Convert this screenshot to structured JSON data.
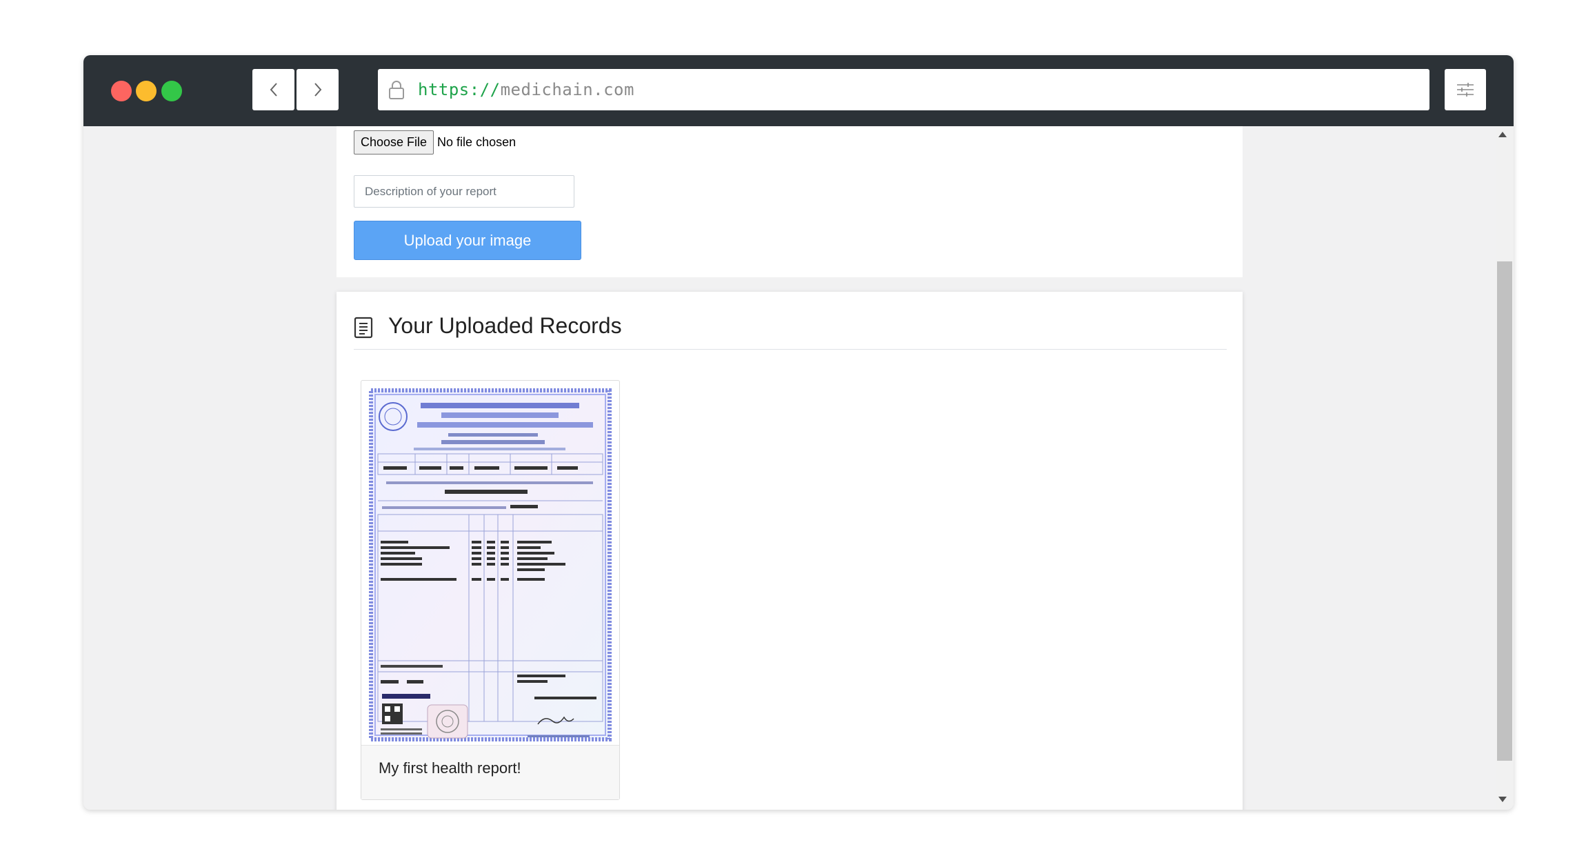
{
  "browser": {
    "url_protocol": "https://",
    "url_host": "medichain.com",
    "back_icon": "chevron-left-icon",
    "forward_icon": "chevron-right-icon",
    "menu_icon": "sliders-icon",
    "lock_icon": "lock-icon"
  },
  "upload_form": {
    "choose_file_label": "Choose File",
    "file_status": "No file chosen",
    "description_placeholder": "Description of your report",
    "description_value": "",
    "upload_button_label": "Upload your image"
  },
  "records": {
    "title": "Your Uploaded Records",
    "title_icon": "document-icon",
    "items": [
      {
        "caption": "My first health report!"
      }
    ]
  },
  "colors": {
    "titlebar": "#2c3237",
    "traffic_red": "#fd6560",
    "traffic_yellow": "#fcbc2e",
    "traffic_green": "#33c748",
    "url_protocol": "#1ea34a",
    "primary_button": "#5ba4f5"
  }
}
